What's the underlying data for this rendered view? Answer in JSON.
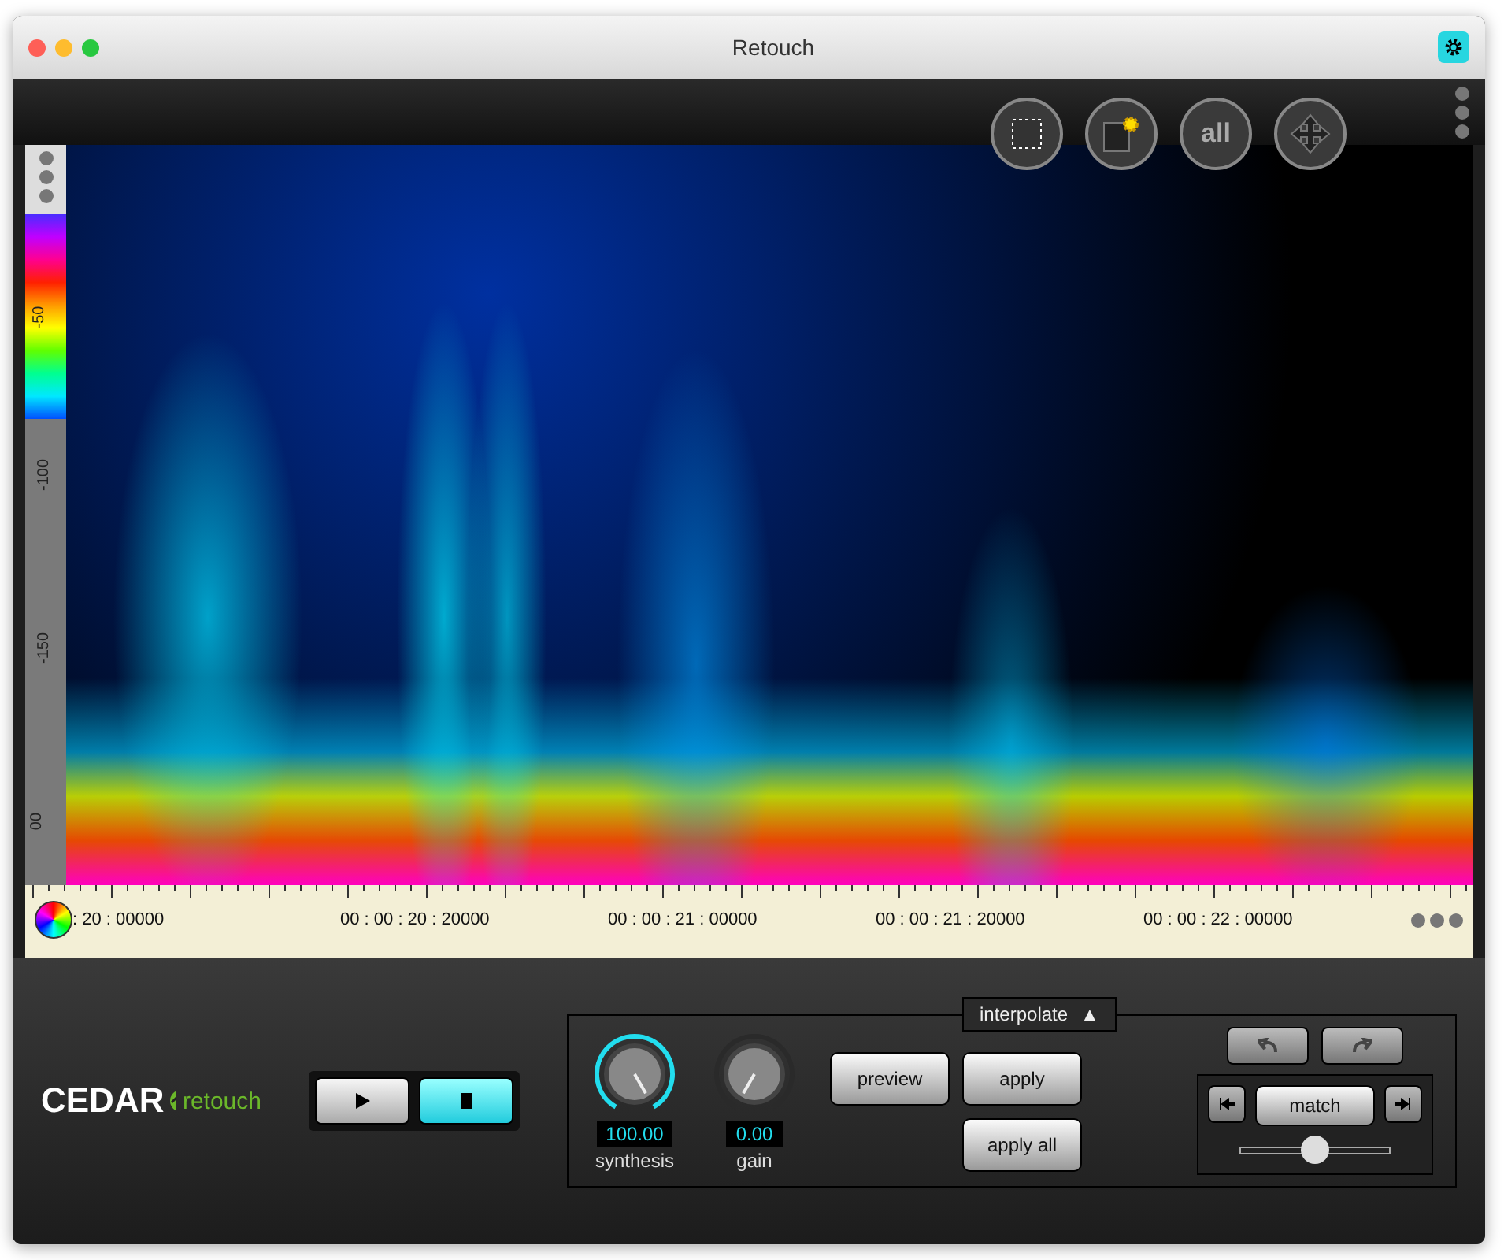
{
  "window": {
    "title": "Retouch"
  },
  "level_scale": {
    "labels": [
      "-50",
      "-100",
      "-150",
      "00"
    ]
  },
  "tools": [
    {
      "kind": "select"
    },
    {
      "kind": "magic"
    },
    {
      "kind": "text",
      "label": "all"
    },
    {
      "kind": "move"
    }
  ],
  "timeline": {
    "labels": [
      ": 20 : 00000",
      "00 : 00 : 20 : 20000",
      "00 : 00 : 21 : 00000",
      "00 : 00 : 21 : 20000",
      "00 : 00 : 22 : 00000"
    ]
  },
  "brand": {
    "name": "CEDAR",
    "product": "retouch"
  },
  "transport": [
    {
      "kind": "play",
      "selected": false
    },
    {
      "kind": "stop",
      "selected": true
    }
  ],
  "mode": {
    "label": "interpolate",
    "arrow": "▲"
  },
  "knobs": [
    {
      "label": "synthesis",
      "value": "100.00",
      "active": true
    },
    {
      "label": "gain",
      "value": "0.00",
      "active": false
    }
  ],
  "actions": [
    "preview",
    "apply",
    "apply all"
  ],
  "match": {
    "label": "match",
    "level": 0.5
  }
}
